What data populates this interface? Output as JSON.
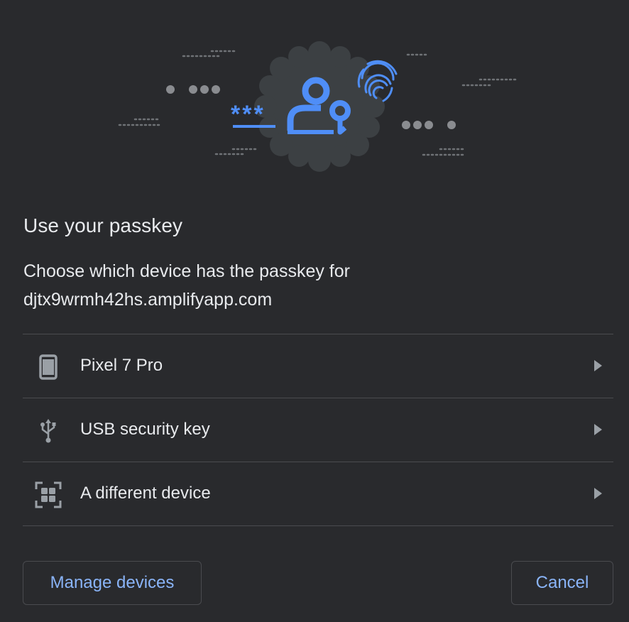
{
  "dialog": {
    "title": "Use your passkey",
    "description_line1": "Choose which device has the passkey for",
    "description_line2": "djtx9wrmh42hs.amplifyapp.com"
  },
  "illustration": {
    "password_mask": "***",
    "icons": [
      "passkey-person-key-icon",
      "fingerprint-icon"
    ]
  },
  "devices": [
    {
      "label": "Pixel 7 Pro",
      "icon": "phone-icon"
    },
    {
      "label": "USB security key",
      "icon": "usb-icon"
    },
    {
      "label": "A different device",
      "icon": "qr-code-icon"
    }
  ],
  "buttons": {
    "manage": "Manage devices",
    "cancel": "Cancel"
  },
  "colors": {
    "background": "#292a2d",
    "accent": "#8ab4f8",
    "illustration_blue": "#4f8ef7",
    "badge": "#3c4043"
  }
}
